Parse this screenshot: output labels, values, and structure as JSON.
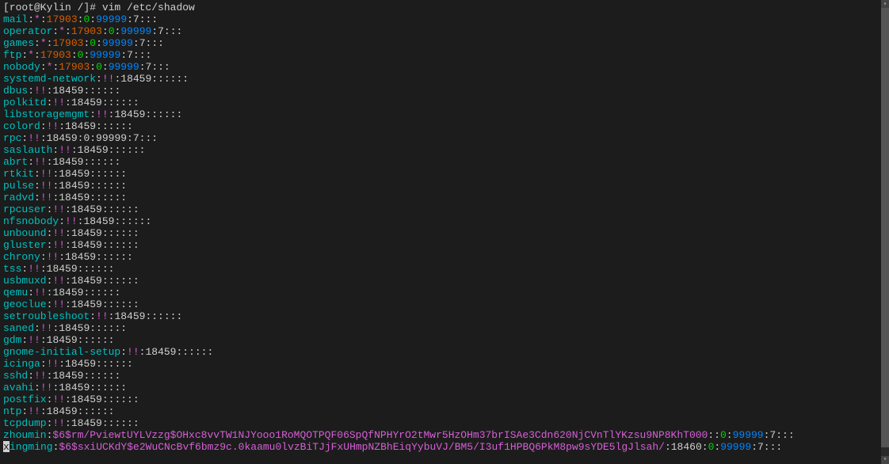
{
  "prompt": "[root@Kylin /]# ",
  "command": "vim /etc/shadow",
  "entries": [
    {
      "u": "mail",
      "p": "*",
      "lc": "17903",
      "mn": "0",
      "mx": "99999",
      "tail": ":7:::"
    },
    {
      "u": "operator",
      "p": "*",
      "lc": "17903",
      "mn": "0",
      "mx": "99999",
      "tail": ":7:::"
    },
    {
      "u": "games",
      "p": "*",
      "lc": "17903",
      "mn": "0",
      "mx": "99999",
      "tail": ":7:::"
    },
    {
      "u": "ftp",
      "p": "*",
      "lc": "17903",
      "mn": "0",
      "mx": "99999",
      "tail": ":7:::"
    },
    {
      "u": "nobody",
      "p": "*",
      "lc": "17903",
      "mn": "0",
      "mx": "99999",
      "tail": ":7:::"
    },
    {
      "u": "systemd-network",
      "p": "!!",
      "lc": "18459",
      "tail": "::::::"
    },
    {
      "u": "dbus",
      "p": "!!",
      "lc": "18459",
      "tail": "::::::"
    },
    {
      "u": "polkitd",
      "p": "!!",
      "lc": "18459",
      "tail": "::::::"
    },
    {
      "u": "libstoragemgmt",
      "p": "!!",
      "lc": "18459",
      "tail": "::::::"
    },
    {
      "u": "colord",
      "p": "!!",
      "lc": "18459",
      "tail": "::::::"
    },
    {
      "u": "rpc",
      "p": "!!",
      "lc": "18459",
      "mn": "0",
      "mx": "99999",
      "tail": ":7:::",
      "rpcstyle": true
    },
    {
      "u": "saslauth",
      "p": "!!",
      "lc": "18459",
      "tail": "::::::"
    },
    {
      "u": "abrt",
      "p": "!!",
      "lc": "18459",
      "tail": "::::::"
    },
    {
      "u": "rtkit",
      "p": "!!",
      "lc": "18459",
      "tail": "::::::"
    },
    {
      "u": "pulse",
      "p": "!!",
      "lc": "18459",
      "tail": "::::::"
    },
    {
      "u": "radvd",
      "p": "!!",
      "lc": "18459",
      "tail": "::::::"
    },
    {
      "u": "rpcuser",
      "p": "!!",
      "lc": "18459",
      "tail": "::::::"
    },
    {
      "u": "nfsnobody",
      "p": "!!",
      "lc": "18459",
      "tail": "::::::"
    },
    {
      "u": "unbound",
      "p": "!!",
      "lc": "18459",
      "tail": "::::::"
    },
    {
      "u": "gluster",
      "p": "!!",
      "lc": "18459",
      "tail": "::::::"
    },
    {
      "u": "chrony",
      "p": "!!",
      "lc": "18459",
      "tail": "::::::"
    },
    {
      "u": "tss",
      "p": "!!",
      "lc": "18459",
      "tail": "::::::"
    },
    {
      "u": "usbmuxd",
      "p": "!!",
      "lc": "18459",
      "tail": "::::::"
    },
    {
      "u": "qemu",
      "p": "!!",
      "lc": "18459",
      "tail": "::::::"
    },
    {
      "u": "geoclue",
      "p": "!!",
      "lc": "18459",
      "tail": "::::::"
    },
    {
      "u": "setroubleshoot",
      "p": "!!",
      "lc": "18459",
      "tail": "::::::"
    },
    {
      "u": "saned",
      "p": "!!",
      "lc": "18459",
      "tail": "::::::"
    },
    {
      "u": "gdm",
      "p": "!!",
      "lc": "18459",
      "tail": "::::::"
    },
    {
      "u": "gnome-initial-setup",
      "p": "!!",
      "lc": "18459",
      "tail": "::::::"
    },
    {
      "u": "icinga",
      "p": "!!",
      "lc": "18459",
      "tail": "::::::"
    },
    {
      "u": "sshd",
      "p": "!!",
      "lc": "18459",
      "tail": "::::::"
    },
    {
      "u": "avahi",
      "p": "!!",
      "lc": "18459",
      "tail": "::::::"
    },
    {
      "u": "postfix",
      "p": "!!",
      "lc": "18459",
      "tail": "::::::"
    },
    {
      "u": "ntp",
      "p": "!!",
      "lc": "18459",
      "tail": "::::::"
    },
    {
      "u": "tcpdump",
      "p": "!!",
      "lc": "18459",
      "tail": "::::::"
    }
  ],
  "hash_lines": [
    {
      "u": "zhoumin",
      "hash": "$6$rm/PviewtUYLVzzg$OHxc8vvTW1NJYooo1RoMQOTPQF06SpQfNPHYrO2tMwr5HzOHm37brISAe3Cdn620NjCVnTlYKzsu9NP8KhT000",
      "lc": "",
      "mn": "0",
      "mx": "99999",
      "tail": ":7:::"
    },
    {
      "u": "ingming",
      "hash": "$6$sxiUCKdY$e2WuCNcBvf6bmz9c.0kaamu0lvzBiTJjFxUHmpNZBhEiqYybuVJ/BM5/I3uf1HPBQ6PkM8pw9sYDE5lgJlsah/",
      "lc": "18460",
      "mn": "0",
      "mx": "99999",
      "tail": ":7:::",
      "cursor": true
    }
  ],
  "scrollbar": {
    "up": "▴",
    "down": "▾"
  }
}
